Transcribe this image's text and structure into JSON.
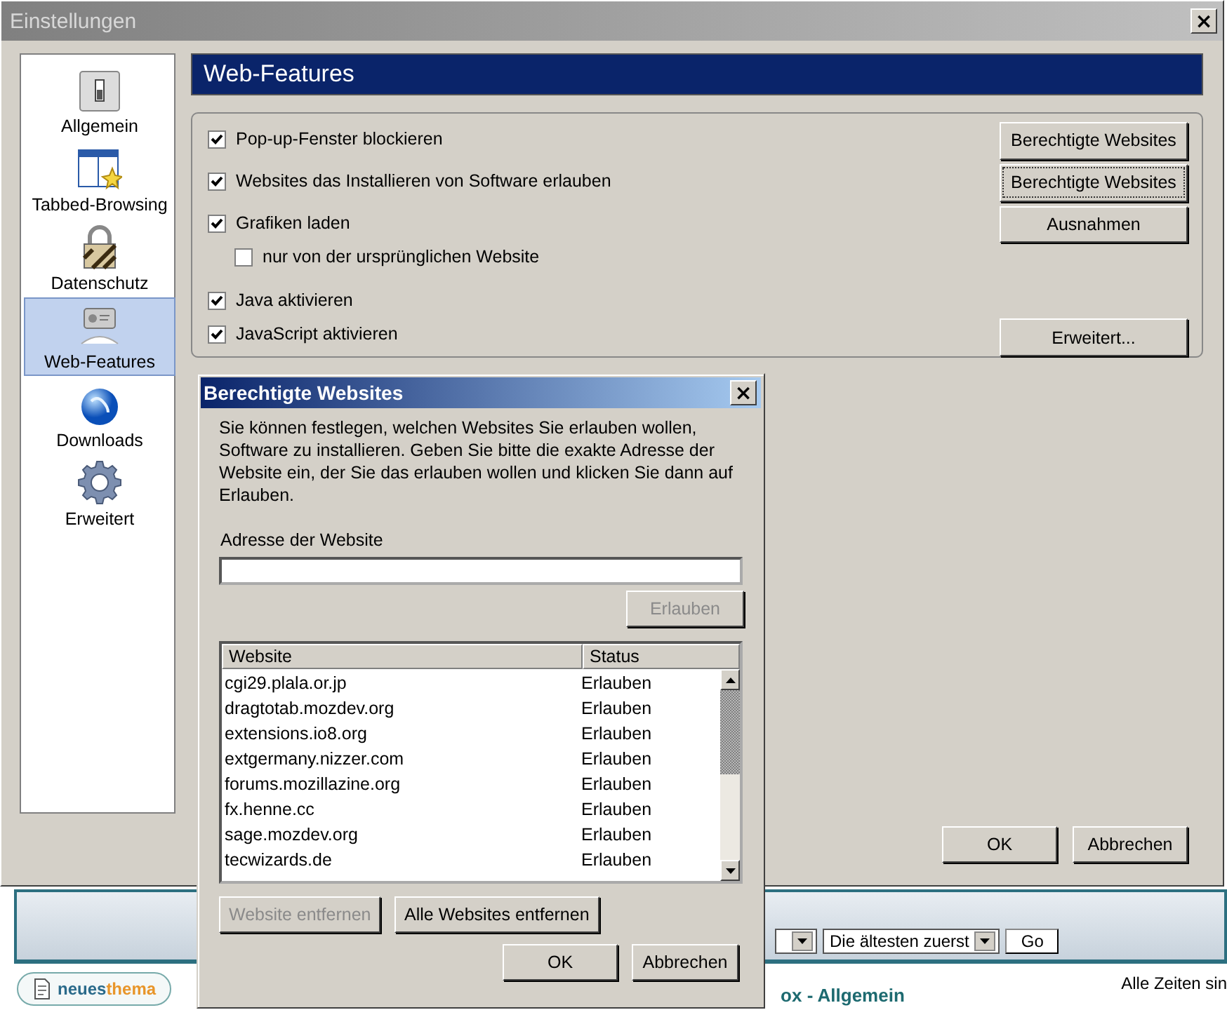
{
  "window": {
    "title": "Einstellungen",
    "close": "×"
  },
  "sidebar": {
    "items": [
      {
        "label": "Allgemein",
        "kind": "switch",
        "selected": false
      },
      {
        "label": "Tabbed-Browsing",
        "kind": "tabs",
        "selected": false
      },
      {
        "label": "Datenschutz",
        "kind": "lock",
        "selected": false
      },
      {
        "label": "Web-Features",
        "kind": "webfeatures",
        "selected": true
      },
      {
        "label": "Downloads",
        "kind": "globe",
        "selected": false
      },
      {
        "label": "Erweitert",
        "kind": "gear",
        "selected": false
      }
    ]
  },
  "panel": {
    "title": "Web-Features",
    "options": [
      {
        "label": "Pop-up-Fenster blockieren",
        "checked": true
      },
      {
        "label": "Websites das Installieren von Software erlauben",
        "checked": true
      },
      {
        "label": "Grafiken laden",
        "checked": true,
        "children": [
          {
            "label": "nur von der ursprünglichen Website",
            "checked": false
          }
        ]
      },
      {
        "label": "Java aktivieren",
        "checked": true
      },
      {
        "label": "JavaScript aktivieren",
        "checked": true
      }
    ],
    "side_buttons": [
      {
        "label": "Berechtigte Websites",
        "focused": false
      },
      {
        "label": "Berechtigte Websites",
        "focused": true
      },
      {
        "label": "Ausnahmen",
        "focused": false
      },
      {
        "label": "Erweitert...",
        "focused": false
      }
    ]
  },
  "footer_buttons": [
    "OK",
    "Abbrechen"
  ],
  "dialog": {
    "title": "Berechtigte Websites",
    "close": "×",
    "description": "Sie können festlegen, welchen Websites Sie erlauben wollen, Software zu installieren. Geben Sie bitte die exakte Adresse der Website ein, der Sie das erlauben wollen und klicken Sie dann auf Erlauben.",
    "address_label": "Adresse der Website",
    "allow_button": {
      "label": "Erlauben",
      "disabled": true
    },
    "columns": [
      "Website",
      "Status"
    ],
    "rows": [
      {
        "website": "cgi29.plala.or.jp",
        "status": "Erlauben"
      },
      {
        "website": "dragtotab.mozdev.org",
        "status": "Erlauben"
      },
      {
        "website": "extensions.io8.org",
        "status": "Erlauben"
      },
      {
        "website": "extgermany.nizzer.com",
        "status": "Erlauben"
      },
      {
        "website": "forums.mozillazine.org",
        "status": "Erlauben"
      },
      {
        "website": "fx.henne.cc",
        "status": "Erlauben"
      },
      {
        "website": "sage.mozdev.org",
        "status": "Erlauben"
      },
      {
        "website": "tecwizards.de",
        "status": "Erlauben"
      }
    ],
    "list_buttons": [
      {
        "label": "Website entfernen",
        "disabled": true
      },
      {
        "label": "Alle Websites entfernen",
        "disabled": false
      }
    ],
    "footer_buttons": [
      "OK",
      "Abbrechen"
    ]
  },
  "background_page": {
    "sort_select": "Die ältesten zuerst",
    "go_button": "Go",
    "new_topic_button": [
      "neues",
      "thema"
    ],
    "forum_link": "ox - Allgemein",
    "time_note": "Alle Zeiten sin"
  }
}
